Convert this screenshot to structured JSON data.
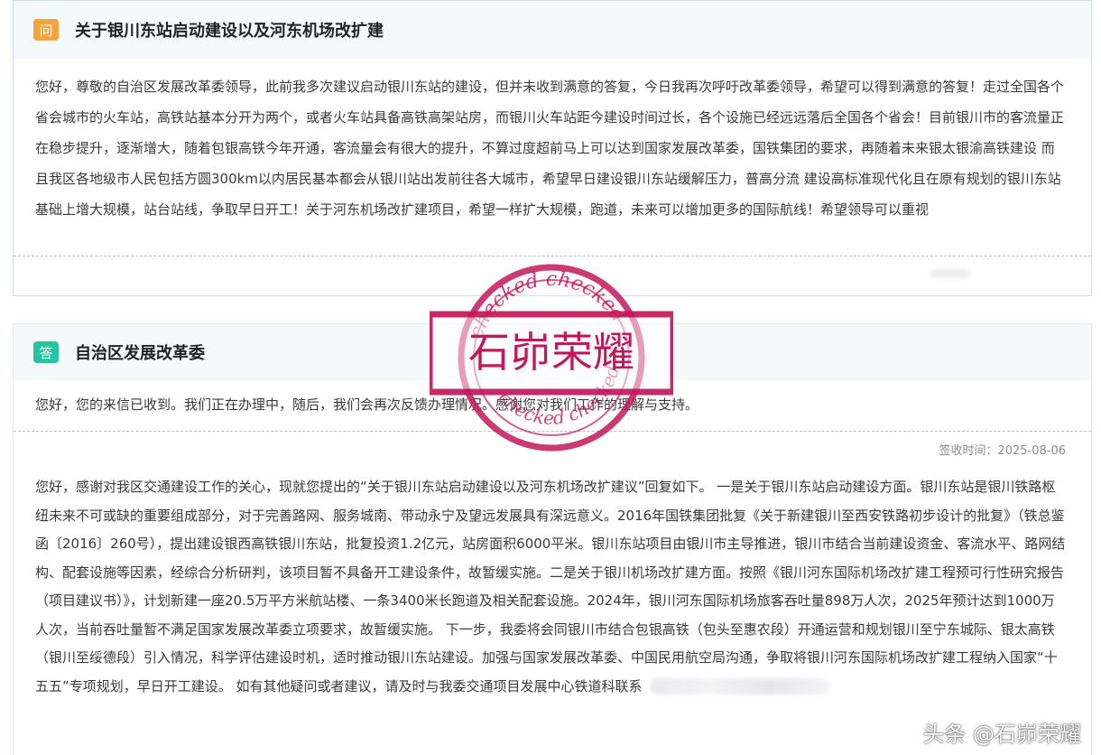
{
  "question": {
    "badge": "问",
    "title": "关于银川东站启动建设以及河东机场改扩建",
    "body": "您好，尊敬的自治区发展改革委领导，此前我多次建议启动银川东站的建设，但并未收到满意的答复，今日我再次呼吁改革委领导，希望可以得到满意的答复！走过全国各个省会城市的火车站，高铁站基本分开为两个，或者火车站具备高铁高架站房，而银川火车站距今建设时间过长，各个设施已经远远落后全国各个省会！目前银川市的客流量正在稳步提升，逐渐增大，随着包银高铁今年开通，客流量会有很大的提升，不算过度超前马上可以达到国家发展改革委，国铁集团的要求，再随着未来银太银渝高铁建设 而且我区各地级市人民包括方圆300km以内居民基本都会从银川站出发前往各大城市，希望早日建设银川东站缓解压力，普高分流 建设高标准现代化且在原有规划的银川东站基础上增大规模，站台站线，争取早日开工！关于河东机场改扩建项目，希望一样扩大规模，跑道，未来可以增加更多的国际航线！希望领导可以重视"
  },
  "answer": {
    "badge": "答",
    "org": "自治区发展改革委",
    "brief": "您好，您的来信已收到。我们正在办理中，随后，我们会再次反馈办理情况。感谢您对我们工作的理解与支持。",
    "receipt": "签收时间：2025-08-06",
    "full": "您好，感谢对我区交通建设工作的关心，现就您提出的“关于银川东站启动建设以及河东机场改扩建议”回复如下。 一是关于银川东站启动建设方面。银川东站是银川铁路枢纽未来不可或缺的重要组成部分，对于完善路网、服务城南、带动永宁及望远发展具有深远意义。2016年国铁集团批复《关于新建银川至西安铁路初步设计的批复》（铁总鉴函〔2016〕260号），提出建设银西高铁银川东站，批复投资1.2亿元，站房面积6000平米。银川东站项目由银川市主导推进，银川市结合当前建设资金、客流水平、路网结构、配套设施等因素，经综合分析研判，该项目暂不具备开工建设条件，故暂缓实施。二是关于银川机场改扩建方面。按照《银川河东国际机场改扩建工程预可行性研究报告（项目建议书）》，计划新建一座20.5万平方米航站楼、一条3400米长跑道及相关配套设施。2024年，银川河东国际机场旅客吞吐量898万人次，2025年预计达到1000万人次，当前吞吐量暂不满足国家发展改革委立项要求，故暂缓实施。 下一步，我委将会同银川市结合包银高铁（包头至惠农段）开通运营和规划银川至宁东城际、银太高铁（银川至绥德段）引入情况，科学评估建设时机，适时推动银川东站建设。加强与国家发展改革委、中国民用航空局沟通，争取将银川河东国际机场改扩建工程纳入国家“十五五”专项规划，早日开工建设。 如有其他疑问或者建议，请及时与我委交通项目发展中心铁道科联系"
  },
  "stamp": {
    "text": "石峁荣耀",
    "ring_text": "checked",
    "color": "#c2185b"
  },
  "watermark": "头条 @石峁荣耀"
}
